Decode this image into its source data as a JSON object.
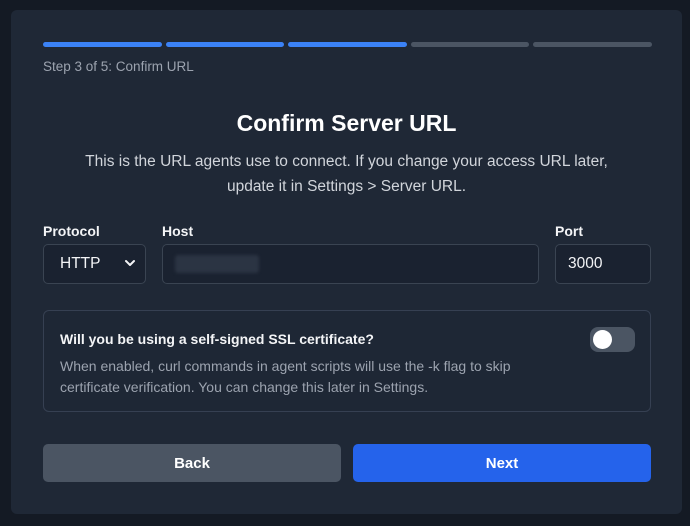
{
  "wizard": {
    "steps_total": 5,
    "steps_completed": 3,
    "step_label": "Step 3 of 5: Confirm URL"
  },
  "header": {
    "title": "Confirm Server URL",
    "subtitle_line1": "This is the URL agents use to connect. If you change your access URL later,",
    "subtitle_line2": "update it in Settings > Server URL."
  },
  "form": {
    "protocol_label": "Protocol",
    "protocol_value": "HTTP",
    "host_label": "Host",
    "port_label": "Port",
    "port_value": "3000"
  },
  "ssl": {
    "question": "Will you be using a self-signed SSL certificate?",
    "description_line1": "When enabled, curl commands in agent scripts will use the -k flag to skip",
    "description_line2": "certificate verification. You can change this later in Settings.",
    "enabled": false
  },
  "buttons": {
    "back_label": "Back",
    "next_label": "Next"
  },
  "icons": {
    "protocol_dropdown": "chevron-down-icon"
  },
  "colors": {
    "accent": "#2563eb",
    "progress_done": "#3b82f6",
    "progress_todo": "#4b5563"
  }
}
